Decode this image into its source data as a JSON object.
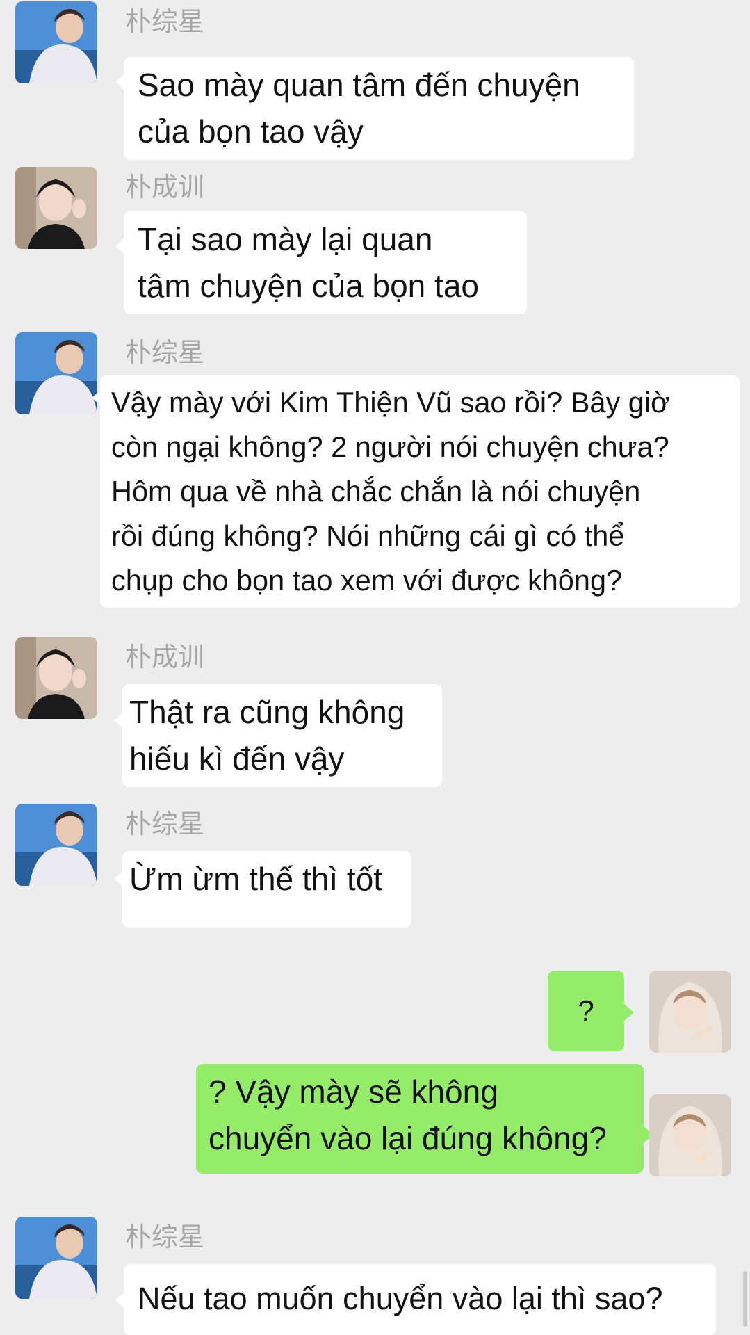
{
  "contacts": {
    "a": "朴综星",
    "b": "朴成训"
  },
  "messages": [
    {
      "id": "m1",
      "sender": "朴综星",
      "text": "Sao mày quan tâm đến chuyện\ncủa bọn tao vậy"
    },
    {
      "id": "m2",
      "sender": "朴成训",
      "text": "Tại sao mày lại quan\ntâm chuyện của bọn tao"
    },
    {
      "id": "m3",
      "sender": "朴综星",
      "text": "Vậy mày với Kim Thiện Vũ sao rồi? Bây giờ\ncòn ngại không? 2 người nói chuyện chưa?\nHôm qua về nhà chắc chắn là nói chuyện\nrồi đúng không? Nói những cái gì có thể\nchụp cho bọn tao xem với được không?"
    },
    {
      "id": "m4",
      "sender": "朴成训",
      "text": "Thật ra cũng không\nhiếu kì đến vậy"
    },
    {
      "id": "m5",
      "sender": "朴综星",
      "text": "Ừm ừm thế thì tốt"
    },
    {
      "id": "m6",
      "sender": "me",
      "text": "?"
    },
    {
      "id": "m7",
      "sender": "me",
      "text": "? Vậy mày sẽ không\nchuyển vào lại đúng không?"
    },
    {
      "id": "m8",
      "sender": "朴综星",
      "text": "Nếu tao muốn chuyển vào lại thì sao?"
    }
  ],
  "colors": {
    "background": "#ededed",
    "incoming_bubble": "#ffffff",
    "outgoing_bubble": "#95ec69",
    "sender_name": "#a6a6a6"
  }
}
